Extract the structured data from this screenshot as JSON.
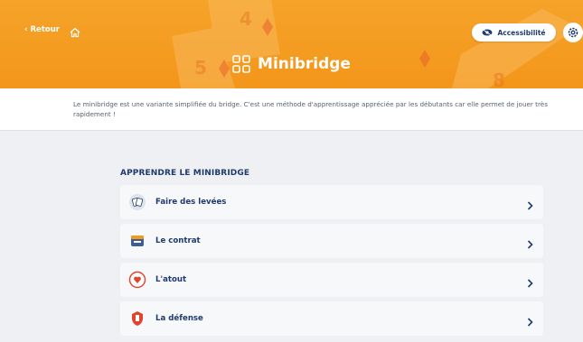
{
  "header": {
    "back_label": "Retour",
    "title": "Minibridge",
    "accessibility_label": "Accessibilité"
  },
  "intro": {
    "text": "Le minibridge est une variante simplifiée du bridge. C'est une méthode d'apprentissage appréciée par les débutants car elle permet de jouer très rapidement !"
  },
  "section": {
    "title": "APPRENDRE LE MINIBRIDGE",
    "items": [
      {
        "label": "Faire des levées",
        "icon": "cards-icon"
      },
      {
        "label": "Le contrat",
        "icon": "contract-icon"
      },
      {
        "label": "L'atout",
        "icon": "trump-icon"
      },
      {
        "label": "La défense",
        "icon": "defense-icon"
      }
    ]
  },
  "colors": {
    "header": "#f5a329",
    "navy": "#1f3a6e",
    "accent_red": "#e0442c"
  }
}
